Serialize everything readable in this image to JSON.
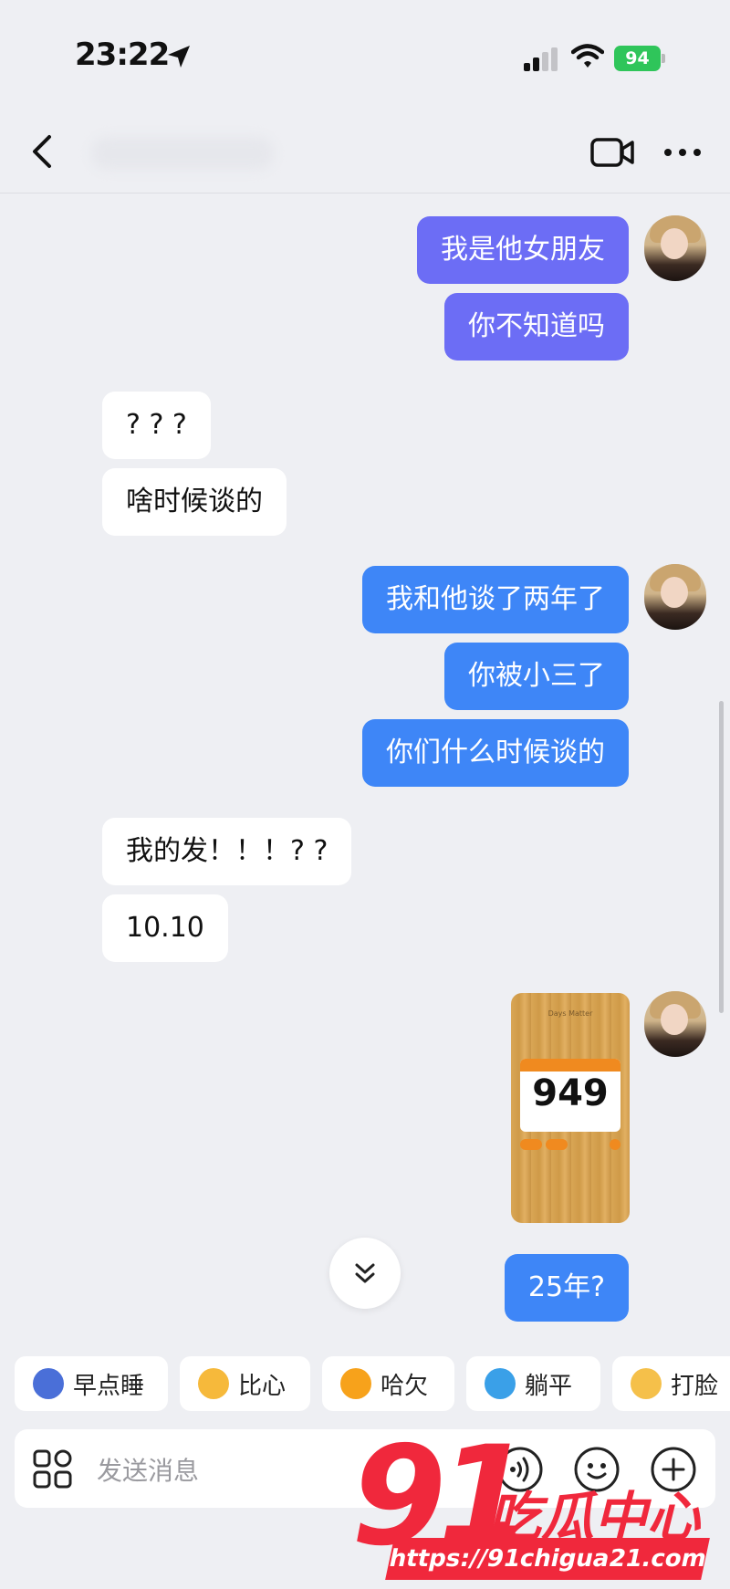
{
  "status_bar": {
    "time": "23:22",
    "battery": "94"
  },
  "header": {
    "icons": [
      "back-icon",
      "video-call-icon",
      "more-icon"
    ]
  },
  "messages": [
    {
      "side": "out",
      "text": "我是他女朋友"
    },
    {
      "side": "out",
      "text": "你不知道吗"
    },
    {
      "side": "in",
      "text": "? ? ?"
    },
    {
      "side": "in",
      "text": "啥时候谈的"
    },
    {
      "side": "out",
      "text": "我和他谈了两年了"
    },
    {
      "side": "out",
      "text": "你被小三了"
    },
    {
      "side": "out",
      "text": "你们什么时候谈的"
    },
    {
      "side": "in",
      "text": "我的发！！！? ?"
    },
    {
      "side": "in",
      "text": "10.10"
    },
    {
      "side": "out",
      "type": "image",
      "app_title": "Days Matter",
      "number": "949"
    },
    {
      "side": "out",
      "text": "25年?"
    }
  ],
  "quick_replies": [
    {
      "label": "早点睡",
      "color": "#4a6fd8"
    },
    {
      "label": "比心",
      "color": "#f6b93b"
    },
    {
      "label": "哈欠",
      "color": "#f7a21b"
    },
    {
      "label": "躺平",
      "color": "#3aa0e8"
    },
    {
      "label": "打脸",
      "color": "#f5c04a"
    }
  ],
  "input": {
    "placeholder": "发送消息"
  },
  "colors": {
    "out_purple": "#6c6df5",
    "out_blue": "#3e86f7",
    "in_bubble": "#ffffff",
    "background": "#eeeff3"
  },
  "watermark": {
    "number": "91",
    "text": "吃瓜中心",
    "url": "https://91chigua21.com"
  }
}
